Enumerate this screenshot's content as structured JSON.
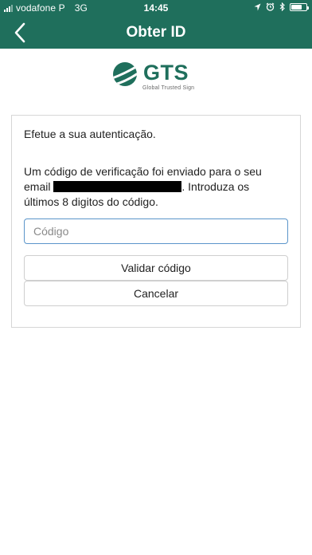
{
  "status_bar": {
    "carrier": "vodafone P",
    "network": "3G",
    "time": "14:45",
    "icons": [
      "signal-icon",
      "location-arrow-icon",
      "alarm-clock-icon",
      "bluetooth-icon",
      "battery-icon"
    ]
  },
  "nav": {
    "title": "Obter ID",
    "back_icon": "chevron-left-icon"
  },
  "logo": {
    "name": "GTS",
    "tagline": "Global Trusted Sign"
  },
  "auth": {
    "heading": "Efetue a sua autenticação.",
    "message_before_email": "Um código de verificação foi enviado para o seu email ",
    "message_after_email": ". Introduza os últimos 8 digitos do código.",
    "code_placeholder": "Código",
    "code_value": "",
    "validate_label": "Validar código",
    "cancel_label": "Cancelar"
  },
  "colors": {
    "brand_green": "#1f6f5c",
    "input_focus_border": "#5b95ca",
    "card_border": "#d6d6d6"
  }
}
